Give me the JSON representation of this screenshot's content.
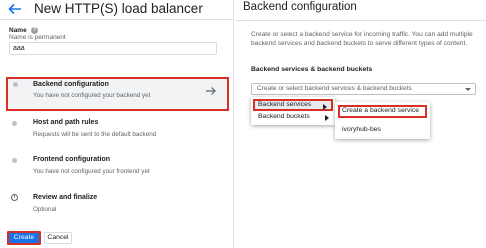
{
  "left_panel": {
    "title": "New HTTP(S) load balancer",
    "name_field": {
      "label": "Name",
      "hint": "Name is permanent",
      "value": "aaa"
    },
    "steps": [
      {
        "title": "Backend configuration",
        "subtitle": "You have not configured your backend yet",
        "active": true
      },
      {
        "title": "Host and path rules",
        "subtitle": "Requests will be sent to the default backend",
        "active": false
      },
      {
        "title": "Frontend configuration",
        "subtitle": "You have not configured your frontend yet",
        "active": false
      },
      {
        "title": "Review and finalize",
        "subtitle": "Optional",
        "active": false
      }
    ],
    "create_label": "Create",
    "cancel_label": "Cancel"
  },
  "right_panel": {
    "title": "Backend configuration",
    "description": "Create or select a backend service for incoming traffic. You can add multiple backend services and backend buckets to serve different types of content.",
    "section_title": "Backend services & backend buckets",
    "select_placeholder": "Create or select backend services & backend buckets",
    "menu_items": [
      "Backend services",
      "Backend buckets"
    ],
    "submenu_items": [
      "Create a backend service",
      "ivoryhub-bes"
    ]
  },
  "colors": {
    "accent": "#1a73e8",
    "highlight_border": "#d93025"
  }
}
